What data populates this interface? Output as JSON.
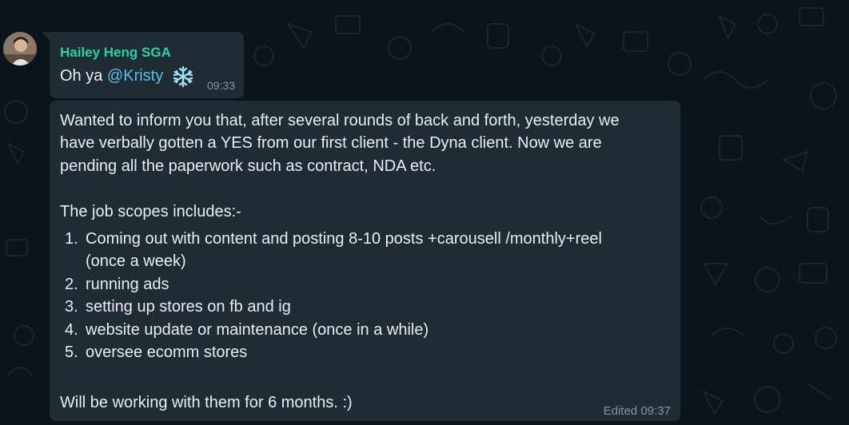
{
  "message1": {
    "sender": "Hailey Heng SGA",
    "text_prefix": "Oh ya",
    "mention": "@Kristy",
    "emoji": "snowflake-icon",
    "time": "09:33"
  },
  "message2": {
    "intro_lines": [
      "Wanted to inform you that, after several rounds of back and forth, yesterday we",
      "have verbally gotten a YES from our first client - the Dyna client. Now we are",
      "pending all the paperwork such as contract, NDA etc."
    ],
    "scope_heading": "The job scopes includes:-",
    "items": [
      {
        "num": "1.",
        "line1": "Coming out with content and posting 8-10 posts +carousell /monthly+reel",
        "line2": "(once a week)"
      },
      {
        "num": "2.",
        "line1": "running ads"
      },
      {
        "num": "3.",
        "line1": "setting up stores on fb and ig"
      },
      {
        "num": "4.",
        "line1": "website update or maintenance (once in a while)"
      },
      {
        "num": "5.",
        "line1": "oversee ecomm stores"
      }
    ],
    "closing": "Will be working with them for 6 months. :)",
    "edited_label": "Edited",
    "time": "09:37"
  },
  "colors": {
    "background": "#0b141a",
    "bubble": "#202c33",
    "sender": "#25d3a6",
    "mention": "#53bdeb",
    "meta": "#8696a0"
  }
}
